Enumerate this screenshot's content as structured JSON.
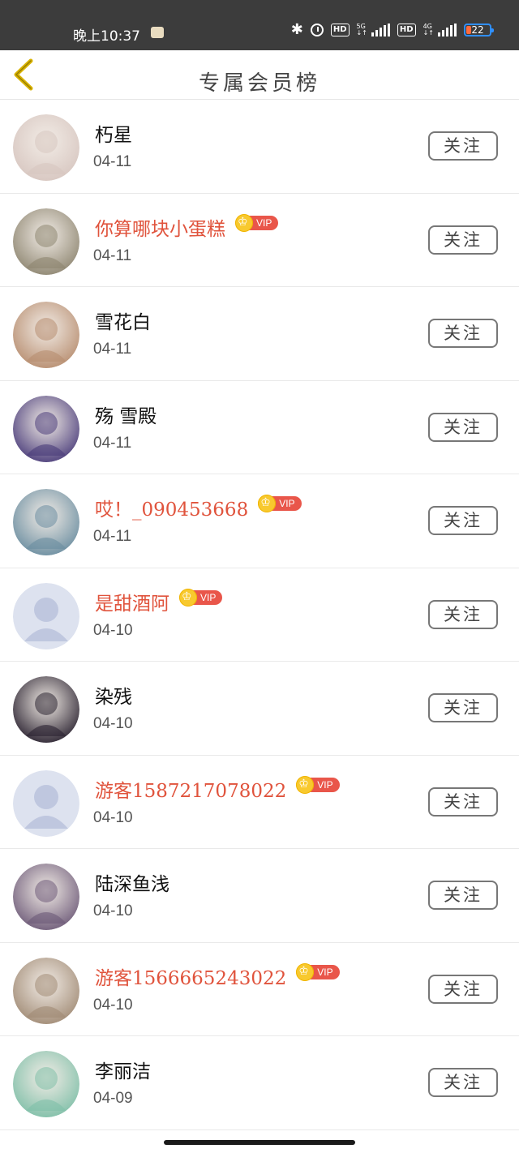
{
  "status_bar": {
    "time": "晚上10:37",
    "hd1": "HD",
    "net1": "5G",
    "hd2": "HD",
    "net2": "4G",
    "battery": "22",
    "icons": [
      "bluetooth-icon",
      "alarm-icon",
      "signal-icon",
      "battery-icon"
    ]
  },
  "header": {
    "title": "专属会员榜",
    "back_icon": "chevron-left-icon",
    "accent": "#d9b300"
  },
  "list": {
    "follow_label": "关注",
    "vip_label": "VIP",
    "items": [
      {
        "name": "朽星",
        "date": "04-11",
        "vip": false,
        "avatar": "#d7c6c0"
      },
      {
        "name": "你算哪块小蛋糕",
        "date": "04-11",
        "vip": true,
        "avatar": "#8d8570"
      },
      {
        "name": "雪花白",
        "date": "04-11",
        "vip": false,
        "avatar": "#b78d6f"
      },
      {
        "name": "殇 雪殿",
        "date": "04-11",
        "vip": false,
        "avatar": "#4a3c7a"
      },
      {
        "name": "哎！_090453668",
        "date": "04-11",
        "vip": true,
        "avatar": "#6a8da0"
      },
      {
        "name": "是甜酒阿",
        "date": "04-10",
        "vip": true,
        "avatar": "default"
      },
      {
        "name": "染残",
        "date": "04-10",
        "vip": false,
        "avatar": "#2a2230"
      },
      {
        "name": "游客1587217078022",
        "date": "04-10",
        "vip": true,
        "avatar": "default"
      },
      {
        "name": "陆深鱼浅",
        "date": "04-10",
        "vip": false,
        "avatar": "#6d5a78"
      },
      {
        "name": "游客1566665243022",
        "date": "04-10",
        "vip": true,
        "avatar": "#a08a74"
      },
      {
        "name": "李丽洁",
        "date": "04-09",
        "vip": false,
        "avatar": "#7fbfa8"
      }
    ]
  },
  "colors": {
    "vip_name": "#e0533c",
    "vip_tag": "#e9564a",
    "crown": "#f8c92e",
    "status_bar_bg": "#3c3c3c"
  }
}
